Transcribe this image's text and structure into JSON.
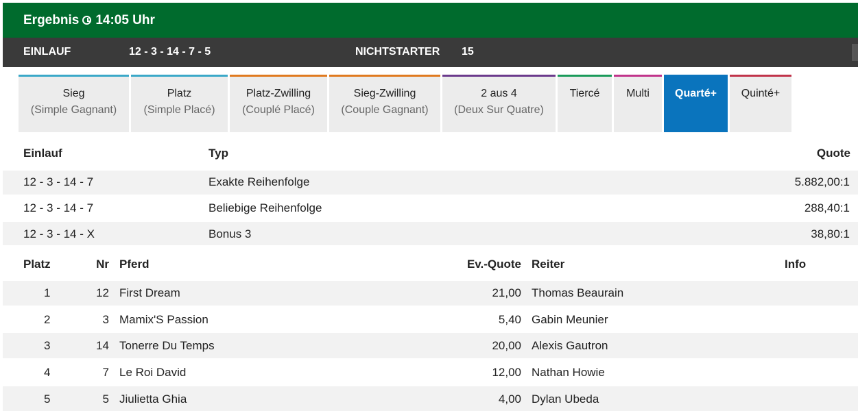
{
  "header": {
    "title": "Ergebnis",
    "time": "14:05 Uhr"
  },
  "info": {
    "einlauf_label": "EINLAUF",
    "einlauf_value": "12 - 3 - 14 - 7 - 5",
    "nichtstarter_label": "NICHTSTARTER",
    "nichtstarter_value": "15"
  },
  "tabs": [
    {
      "label": "Sieg",
      "sub": "(Simple Gagnant)",
      "color": "#3aa8c8"
    },
    {
      "label": "Platz",
      "sub": "(Simple Placé)",
      "color": "#3aa8c8"
    },
    {
      "label": "Platz-Zwilling",
      "sub": "(Couplé Placé)",
      "color": "#e07a1f"
    },
    {
      "label": "Sieg-Zwilling",
      "sub": "(Couple Gagnant)",
      "color": "#e07a1f"
    },
    {
      "label": "2 aus 4",
      "sub": "(Deux Sur Quatre)",
      "color": "#6b3a8c"
    },
    {
      "label": "Tiercé",
      "sub": "",
      "color": "#1a9a5a"
    },
    {
      "label": "Multi",
      "sub": "",
      "color": "#c0338a"
    },
    {
      "label": "Quarté+",
      "sub": "",
      "color": "#0a74bd",
      "active": true
    },
    {
      "label": "Quinté+",
      "sub": "",
      "color": "#c0334a"
    }
  ],
  "payout_table": {
    "headers": {
      "einlauf": "Einlauf",
      "typ": "Typ",
      "quote": "Quote"
    },
    "rows": [
      {
        "einlauf": "12 - 3 - 14 - 7",
        "typ": "Exakte Reihenfolge",
        "quote": "5.882,00:1"
      },
      {
        "einlauf": "12 - 3 - 14 - 7",
        "typ": "Beliebige Reihenfolge",
        "quote": "288,40:1"
      },
      {
        "einlauf": "12 - 3 - 14 - X",
        "typ": "Bonus 3",
        "quote": "38,80:1"
      }
    ]
  },
  "results_table": {
    "headers": {
      "platz": "Platz",
      "nr": "Nr",
      "pferd": "Pferd",
      "ev_quote": "Ev.-Quote",
      "reiter": "Reiter",
      "info": "Info"
    },
    "rows": [
      {
        "platz": "1",
        "nr": "12",
        "pferd": "First Dream",
        "ev_quote": "21,00",
        "reiter": "Thomas Beaurain"
      },
      {
        "platz": "2",
        "nr": "3",
        "pferd": "Mamix'S Passion",
        "ev_quote": "5,40",
        "reiter": "Gabin Meunier"
      },
      {
        "platz": "3",
        "nr": "14",
        "pferd": "Tonerre Du Temps",
        "ev_quote": "20,00",
        "reiter": "Alexis Gautron"
      },
      {
        "platz": "4",
        "nr": "7",
        "pferd": "Le Roi David",
        "ev_quote": "12,00",
        "reiter": "Nathan Howie"
      },
      {
        "platz": "5",
        "nr": "5",
        "pferd": "Jiulietta Ghia",
        "ev_quote": "4,00",
        "reiter": "Dylan Ubeda"
      }
    ]
  }
}
